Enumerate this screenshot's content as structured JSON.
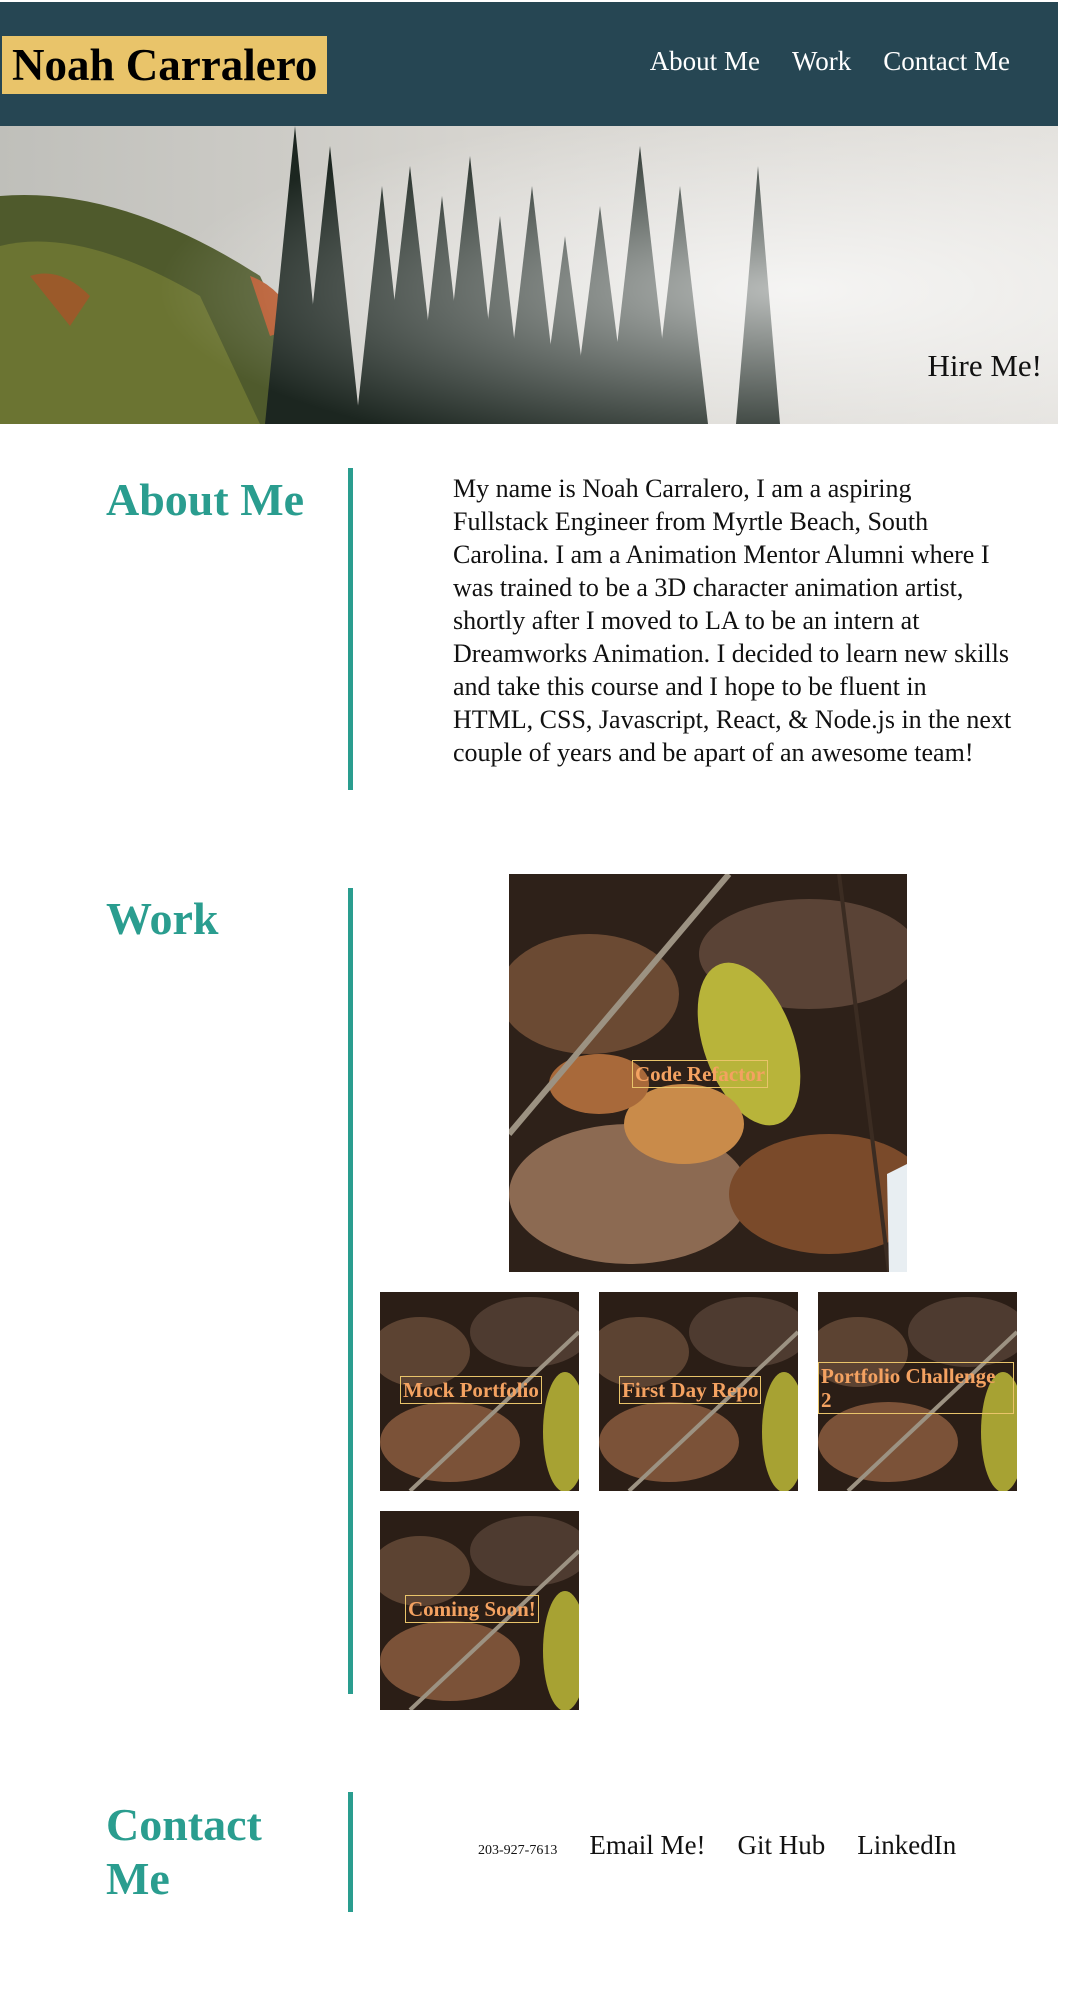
{
  "header": {
    "brand": "Noah Carralero",
    "nav": [
      "About Me",
      "Work",
      "Contact Me"
    ]
  },
  "hero": {
    "cta": "Hire Me!"
  },
  "about": {
    "title": "About Me",
    "body": "My name is Noah Carralero, I am a aspiring Fullstack Engineer from Myrtle Beach, South Carolina. I am a Animation Mentor Alumni where I was trained to be a 3D character animation artist, shortly after I moved to LA to be an intern at Dreamworks Animation. I decided to learn new skills and take this course and I hope to be fluent in HTML, CSS, Javascript, React, & Node.js in the next couple of years and be apart of an awesome team!"
  },
  "work": {
    "title": "Work",
    "projects": [
      {
        "label": "Code Refactor"
      },
      {
        "label": "Mock Portfolio"
      },
      {
        "label": "First Day Repo"
      },
      {
        "label": "Portfolio Challenge 2"
      },
      {
        "label": "Coming Soon!"
      }
    ]
  },
  "contact": {
    "title": "Contact Me",
    "phone": "203-927-7613",
    "links": [
      "Email Me!",
      "Git Hub",
      "LinkedIn"
    ]
  },
  "colors": {
    "header_bg": "#264653",
    "brand_bg": "#e9c46a",
    "accent": "#2a9d8f",
    "label": "#f4a261"
  }
}
